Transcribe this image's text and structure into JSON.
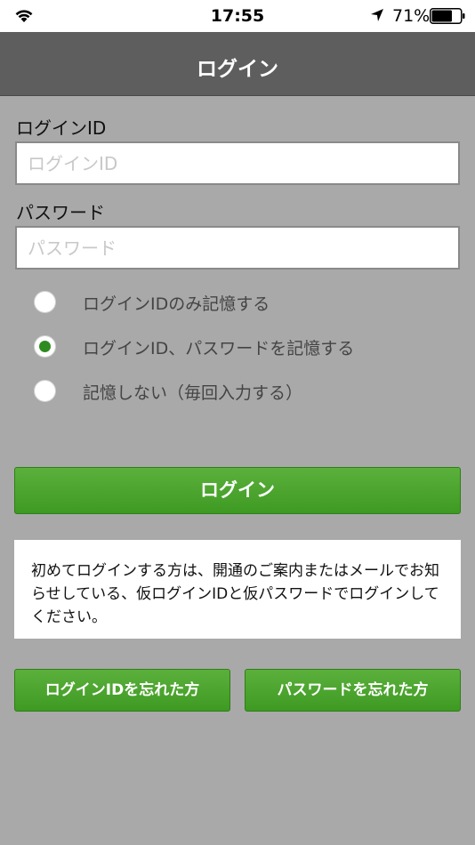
{
  "status_bar": {
    "time": "17:55",
    "battery_percent": "71%",
    "battery_level": 0.71,
    "icons": [
      "wifi-icon",
      "location-arrow-icon",
      "battery-icon"
    ]
  },
  "nav": {
    "title": "ログイン"
  },
  "form": {
    "login_id_label": "ログインID",
    "login_id_placeholder": "ログインID",
    "login_id_value": "",
    "password_label": "パスワード",
    "password_placeholder": "パスワード",
    "password_value": ""
  },
  "remember_options": [
    {
      "label": "ログインIDのみ記憶する",
      "checked": false
    },
    {
      "label": "ログインID、パスワードを記憶する",
      "checked": true
    },
    {
      "label": "記憶しない（毎回入力する）",
      "checked": false
    }
  ],
  "login_button_label": "ログイン",
  "notice_text": "初めてログインする方は、開通のご案内またはメールでお知らせしている、仮ログインIDと仮パスワードでログインしてください。",
  "forgot": {
    "id_label": "ログインIDを忘れた方",
    "password_label": "パスワードを忘れた方"
  },
  "colors": {
    "accent_green": "#3e9a22",
    "nav_background": "#5e5e5e",
    "page_background": "#a9a9a9"
  }
}
